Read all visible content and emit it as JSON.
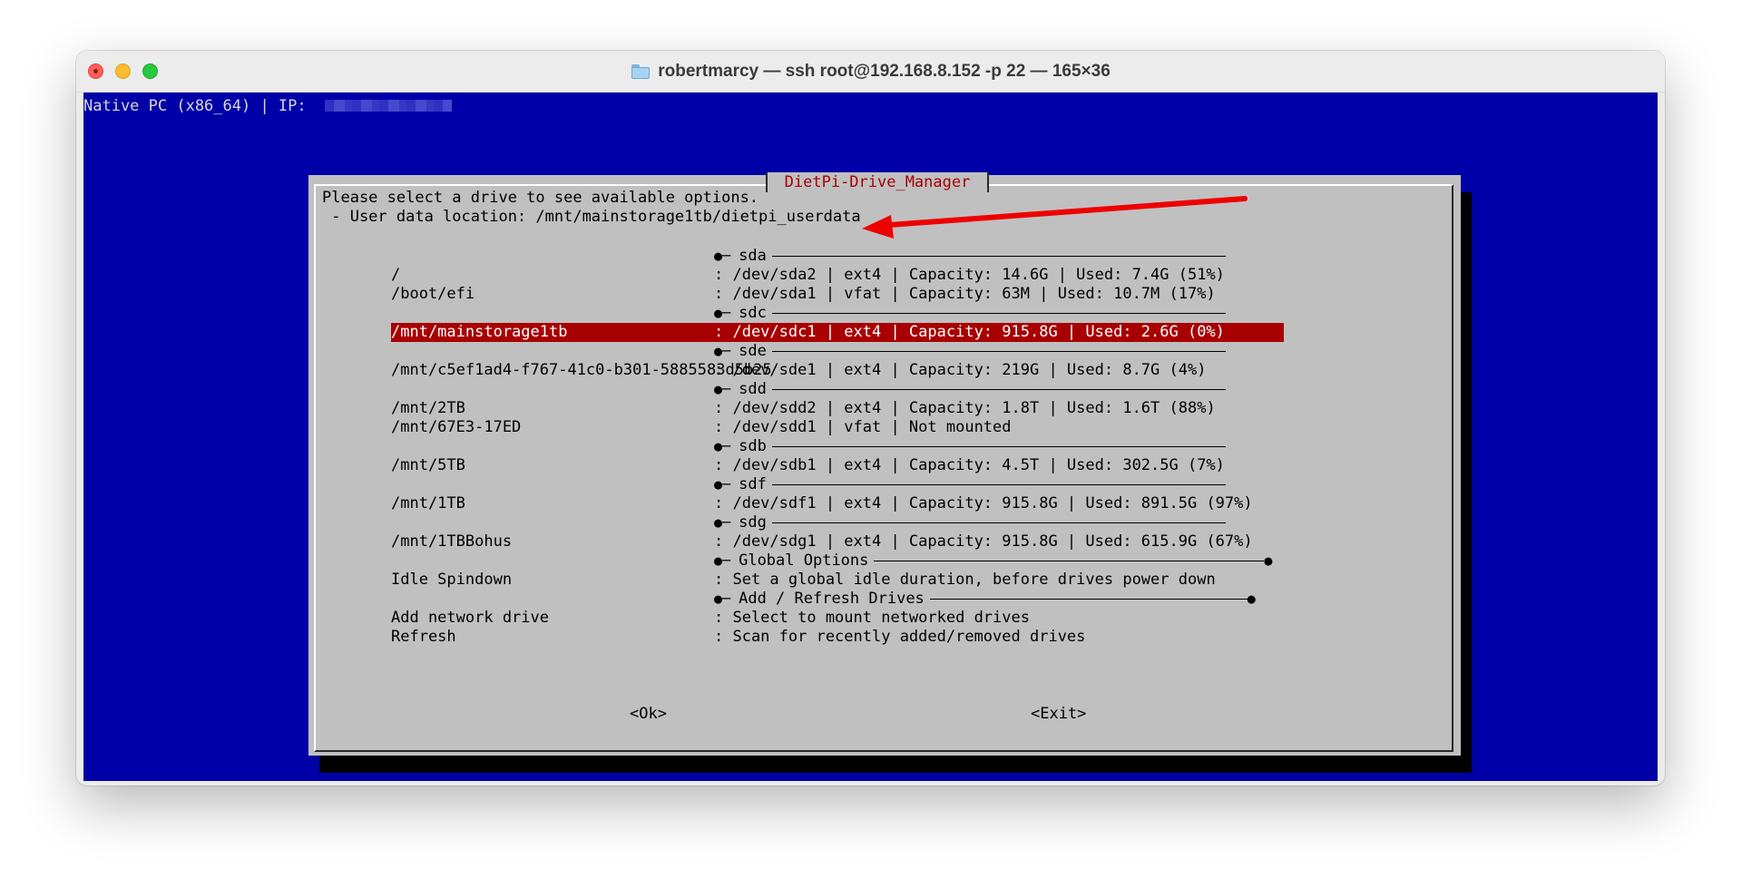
{
  "window": {
    "title": "robertmarcy — ssh root@192.168.8.152 -p 22 — 165×36"
  },
  "terminal": {
    "status_line": "Native PC (x86_64) | IP:"
  },
  "dialog": {
    "title": "DietPi-Drive_Manager",
    "prompt": "Please select a drive to see available options.",
    "user_data": " - User data location: /mnt/mainstorage1tb/dietpi_userdata",
    "groups": [
      {
        "label": "sda",
        "rows": [
          {
            "mount": "/",
            "info": ": /dev/sda2 | ext4 | Capacity: 14.6G | Used: 7.4G (51%)"
          },
          {
            "mount": "/boot/efi",
            "info": ": /dev/sda1 | vfat | Capacity: 63M | Used: 10.7M (17%)"
          }
        ]
      },
      {
        "label": "sdc",
        "rows": [
          {
            "mount": "/mnt/mainstorage1tb",
            "info": ": /dev/sdc1 | ext4 | Capacity: 915.8G | Used: 2.6G (0%)",
            "selected": true
          }
        ]
      },
      {
        "label": "sde",
        "rows": [
          {
            "mount": "/mnt/c5ef1ad4-f767-41c0-b301-5885583d5b25",
            "info": ": /dev/sde1 | ext4 | Capacity: 219G | Used: 8.7G (4%)"
          }
        ]
      },
      {
        "label": "sdd",
        "rows": [
          {
            "mount": "/mnt/2TB",
            "info": ": /dev/sdd2 | ext4 | Capacity: 1.8T | Used: 1.6T (88%)"
          },
          {
            "mount": "/mnt/67E3-17ED",
            "info": ": /dev/sdd1 | vfat | Not mounted"
          }
        ]
      },
      {
        "label": "sdb",
        "rows": [
          {
            "mount": "/mnt/5TB",
            "info": ": /dev/sdb1 | ext4 | Capacity: 4.5T | Used: 302.5G (7%)"
          }
        ]
      },
      {
        "label": "sdf",
        "rows": [
          {
            "mount": "/mnt/1TB",
            "info": ": /dev/sdf1 | ext4 | Capacity: 915.8G | Used: 891.5G (97%)"
          }
        ]
      },
      {
        "label": "sdg",
        "rows": [
          {
            "mount": "/mnt/1TBBohus",
            "info": ": /dev/sdg1 | ext4 | Capacity: 915.8G | Used: 615.9G (67%)"
          }
        ]
      },
      {
        "label": "Global Options",
        "rows": [
          {
            "mount": "Idle Spindown",
            "info": ": Set a global idle duration, before drives power down"
          }
        ]
      },
      {
        "label": "Add / Refresh Drives",
        "rows": [
          {
            "mount": "Add network drive",
            "info": ": Select to mount networked drives"
          },
          {
            "mount": "Refresh",
            "info": ": Scan for recently added/removed drives"
          }
        ]
      }
    ],
    "buttons": {
      "ok": "<Ok>",
      "exit": "<Exit>"
    }
  },
  "colors": {
    "terminal_bg": "#0000a8",
    "dialog_bg": "#c0c0c0",
    "selection": "#a80000",
    "title_red": "#a80000",
    "annotation_arrow": "#ee0000"
  },
  "icons": [
    "folder-icon",
    "arrow-annotation-icon"
  ]
}
